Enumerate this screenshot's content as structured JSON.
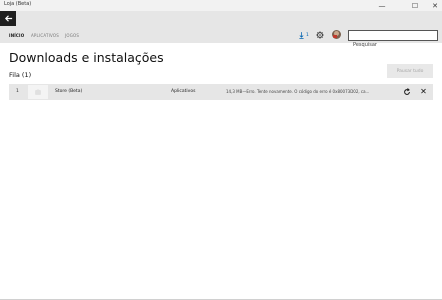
{
  "window": {
    "title": "Loja (Beta)",
    "minimize_glyph": "—",
    "maximize_glyph": "☐",
    "close_glyph": "✕"
  },
  "nav": {
    "back_icon": "back-arrow-icon",
    "tabs": [
      {
        "label": "INÍCIO",
        "active": true
      },
      {
        "label": "APLICATIVOS",
        "active": false
      },
      {
        "label": "JOGOS",
        "active": false
      }
    ],
    "downloads_count": "1",
    "search": {
      "placeholder": "Pesquisar",
      "value": ""
    }
  },
  "page": {
    "title": "Downloads e instalações",
    "pause_all_label": "Pausar tudo",
    "queue_label": "Fila (1)"
  },
  "queue": [
    {
      "index": "1",
      "name": "Store (Beta)",
      "category": "Aplicativos",
      "status": "14,3 MB—Erro. Tente novamente. O código do erro é 0x80073D02, ca..."
    }
  ],
  "colors": {
    "accent": "#0063b1",
    "nav_bg": "#e6e6e6",
    "row_bg": "#e6e6e6",
    "back_bg": "#1f1f1f"
  }
}
